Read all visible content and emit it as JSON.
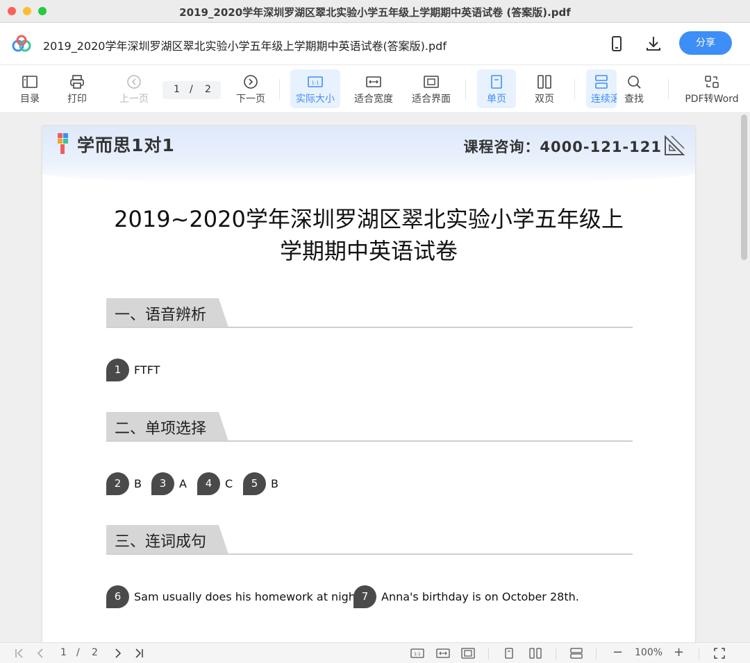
{
  "window": {
    "title": "2019_2020学年深圳罗湖区翠北实验小学五年级上学期期中英语试卷 (答案版).pdf"
  },
  "appbar": {
    "doc_name": "2019_2020学年深圳罗湖区翠北实验小学五年级上学期期中英语试卷(答案版).pdf",
    "share_label": "分享",
    "icons": [
      "logo-icon",
      "phone-icon",
      "download-icon"
    ]
  },
  "toolbar": {
    "toc": "目录",
    "print": "打印",
    "prev_page": "上一页",
    "page_current": "1",
    "page_sep": "/",
    "page_total": "2",
    "next_page": "下一页",
    "actual_size": "实际大小",
    "fit_width": "适合宽度",
    "fit_page": "适合界面",
    "single_page": "单页",
    "double_page": "双页",
    "continuous": "连续滚",
    "find": "查找",
    "pdf_to_word": "PDF转Word",
    "accent_color": "#3e8ef7"
  },
  "page": {
    "brand": "学而思1对1",
    "consult": "课程咨询：4000-121-121",
    "title_line1": "2019~2020学年深圳罗湖区翠北实验小学五年级上",
    "title_line2": "学期期中英语试卷",
    "sections": [
      {
        "label": "一、语音辨析",
        "answers": [
          {
            "num": "1",
            "text": "FTFT"
          }
        ]
      },
      {
        "label": "二、单项选择",
        "answers": [
          {
            "num": "2",
            "text": "B"
          },
          {
            "num": "3",
            "text": "A"
          },
          {
            "num": "4",
            "text": "C"
          },
          {
            "num": "5",
            "text": "B"
          }
        ]
      },
      {
        "label": "三、连词成句",
        "answers": [
          {
            "num": "6",
            "text": "Sam usually does his homework at night."
          },
          {
            "num": "7",
            "text": "Anna's birthday is on October 28th."
          }
        ]
      }
    ]
  },
  "statusbar": {
    "page_current": "1",
    "page_sep": "/",
    "page_total": "2",
    "zoom_minus": "−",
    "zoom": "100%",
    "zoom_plus": "+"
  }
}
